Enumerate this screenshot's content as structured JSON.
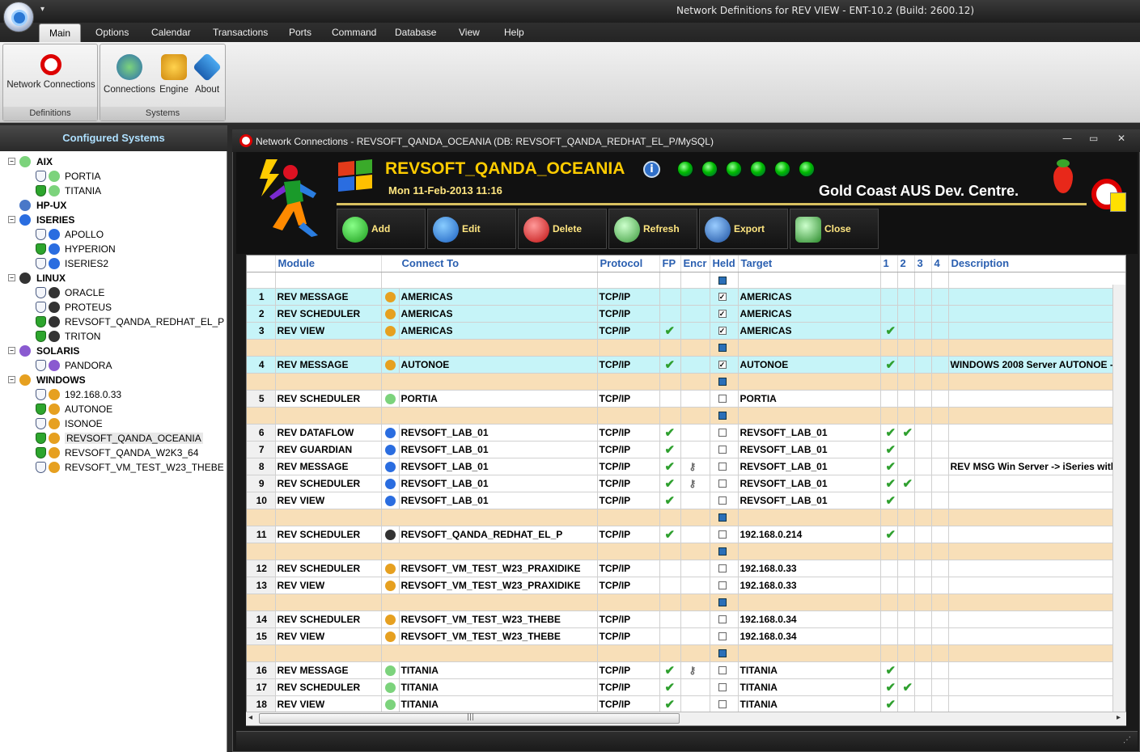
{
  "window": {
    "title": "Network Definitions for REV VIEW - ENT-10.2 (Build: 2600.12)"
  },
  "menu": [
    "Main",
    "Options",
    "Calendar",
    "Transactions",
    "Ports",
    "Command",
    "Database",
    "View",
    "Help"
  ],
  "ribbon": {
    "definitions": {
      "label": "Definitions",
      "network_connections": "Network Connections"
    },
    "systems": {
      "label": "Systems",
      "connections": "Connections",
      "engine": "Engine",
      "about": "About"
    }
  },
  "tree": {
    "title": "Configured Systems",
    "categories": [
      {
        "name": "AIX",
        "children": [
          "PORTIA",
          "TITANIA"
        ]
      },
      {
        "name": "HP-UX",
        "children": []
      },
      {
        "name": "ISERIES",
        "children": [
          "APOLLO",
          "HYPERION",
          "ISERIES2"
        ]
      },
      {
        "name": "LINUX",
        "children": [
          "ORACLE",
          "PROTEUS",
          "REVSOFT_QANDA_REDHAT_EL_P",
          "TRITON"
        ]
      },
      {
        "name": "SOLARIS",
        "children": [
          "PANDORA"
        ]
      },
      {
        "name": "WINDOWS",
        "children": [
          "192.168.0.33",
          "AUTONOE",
          "ISONOE",
          "REVSOFT_QANDA_OCEANIA",
          "REVSOFT_QANDA_W2K3_64",
          "REVSOFT_VM_TEST_W23_THEBE"
        ]
      }
    ]
  },
  "child": {
    "title": "Network Connections - REVSOFT_QANDA_OCEANIA (DB: REVSOFT_QANDA_REDHAT_EL_P/MySQL)",
    "system_name": "REVSOFT_QANDA_OCEANIA",
    "datetime": "Mon 11-Feb-2013 11:16",
    "location": "Gold Coast AUS Dev. Centre.",
    "toolbar": {
      "add": "Add",
      "edit": "Edit",
      "delete": "Delete",
      "refresh": "Refresh",
      "export": "Export",
      "close": "Close"
    }
  },
  "grid": {
    "headers": {
      "module": "Module",
      "connect_to": "Connect To",
      "protocol": "Protocol",
      "fp": "FP",
      "encr": "Encr",
      "held": "Held",
      "target": "Target",
      "c1": "1",
      "c2": "2",
      "c3": "3",
      "c4": "4",
      "description": "Description"
    },
    "rows": [
      {
        "n": "1",
        "module": "REV MESSAGE",
        "connect": "AMERICAS",
        "os": "windows",
        "protocol": "TCP/IP",
        "fp": false,
        "encr": false,
        "held": true,
        "target": "AMERICAS",
        "c1": false,
        "c2": false,
        "desc": "",
        "cyan": true
      },
      {
        "n": "2",
        "module": "REV SCHEDULER",
        "connect": "AMERICAS",
        "os": "windows",
        "protocol": "TCP/IP",
        "fp": false,
        "encr": false,
        "held": true,
        "target": "AMERICAS",
        "c1": false,
        "c2": false,
        "desc": "",
        "cyan": true
      },
      {
        "n": "3",
        "module": "REV VIEW",
        "connect": "AMERICAS",
        "os": "windows",
        "protocol": "TCP/IP",
        "fp": true,
        "encr": false,
        "held": true,
        "target": "AMERICAS",
        "c1": true,
        "c2": false,
        "desc": "",
        "cyan": true
      },
      {
        "sep": true
      },
      {
        "n": "4",
        "module": "REV MESSAGE",
        "connect": "AUTONOE",
        "os": "windows",
        "protocol": "TCP/IP",
        "fp": true,
        "encr": false,
        "held": true,
        "target": "AUTONOE",
        "c1": true,
        "c2": false,
        "desc": "WINDOWS 2008 Server AUTONOE -",
        "cyan": true
      },
      {
        "sep": true
      },
      {
        "n": "5",
        "module": "REV SCHEDULER",
        "connect": "PORTIA",
        "os": "aix",
        "protocol": "TCP/IP",
        "fp": false,
        "encr": false,
        "held": false,
        "target": "PORTIA",
        "c1": false,
        "c2": false,
        "desc": ""
      },
      {
        "sep": true
      },
      {
        "n": "6",
        "module": "REV DATAFLOW",
        "connect": "REVSOFT_LAB_01",
        "os": "iseries",
        "protocol": "TCP/IP",
        "fp": true,
        "encr": false,
        "held": false,
        "target": "REVSOFT_LAB_01",
        "c1": true,
        "c2": true,
        "desc": ""
      },
      {
        "n": "7",
        "module": "REV GUARDIAN",
        "connect": "REVSOFT_LAB_01",
        "os": "iseries",
        "protocol": "TCP/IP",
        "fp": true,
        "encr": false,
        "held": false,
        "target": "REVSOFT_LAB_01",
        "c1": true,
        "c2": false,
        "desc": ""
      },
      {
        "n": "8",
        "module": "REV MESSAGE",
        "connect": "REVSOFT_LAB_01",
        "os": "iseries",
        "protocol": "TCP/IP",
        "fp": true,
        "encr": true,
        "held": false,
        "target": "REVSOFT_LAB_01",
        "c1": true,
        "c2": false,
        "desc": "REV MSG Win Server -> iSeries with"
      },
      {
        "n": "9",
        "module": "REV SCHEDULER",
        "connect": "REVSOFT_LAB_01",
        "os": "iseries",
        "protocol": "TCP/IP",
        "fp": true,
        "encr": true,
        "held": false,
        "target": "REVSOFT_LAB_01",
        "c1": true,
        "c2": true,
        "desc": ""
      },
      {
        "n": "10",
        "module": "REV VIEW",
        "connect": "REVSOFT_LAB_01",
        "os": "iseries",
        "protocol": "TCP/IP",
        "fp": true,
        "encr": false,
        "held": false,
        "target": "REVSOFT_LAB_01",
        "c1": true,
        "c2": false,
        "desc": ""
      },
      {
        "sep": true
      },
      {
        "n": "11",
        "module": "REV SCHEDULER",
        "connect": "REVSOFT_QANDA_REDHAT_EL_P",
        "os": "linux",
        "protocol": "TCP/IP",
        "fp": true,
        "encr": false,
        "held": false,
        "target": "192.168.0.214",
        "c1": true,
        "c2": false,
        "desc": ""
      },
      {
        "sep": true
      },
      {
        "n": "12",
        "module": "REV SCHEDULER",
        "connect": "REVSOFT_VM_TEST_W23_PRAXIDIKE",
        "os": "windows",
        "protocol": "TCP/IP",
        "fp": false,
        "encr": false,
        "held": false,
        "target": "192.168.0.33",
        "c1": false,
        "c2": false,
        "desc": ""
      },
      {
        "n": "13",
        "module": "REV VIEW",
        "connect": "REVSOFT_VM_TEST_W23_PRAXIDIKE",
        "os": "windows",
        "protocol": "TCP/IP",
        "fp": false,
        "encr": false,
        "held": false,
        "target": "192.168.0.33",
        "c1": false,
        "c2": false,
        "desc": ""
      },
      {
        "sep": true
      },
      {
        "n": "14",
        "module": "REV SCHEDULER",
        "connect": "REVSOFT_VM_TEST_W23_THEBE",
        "os": "windows",
        "protocol": "TCP/IP",
        "fp": false,
        "encr": false,
        "held": false,
        "target": "192.168.0.34",
        "c1": false,
        "c2": false,
        "desc": ""
      },
      {
        "n": "15",
        "module": "REV VIEW",
        "connect": "REVSOFT_VM_TEST_W23_THEBE",
        "os": "windows",
        "protocol": "TCP/IP",
        "fp": false,
        "encr": false,
        "held": false,
        "target": "192.168.0.34",
        "c1": false,
        "c2": false,
        "desc": ""
      },
      {
        "sep": true
      },
      {
        "n": "16",
        "module": "REV MESSAGE",
        "connect": "TITANIA",
        "os": "aix",
        "protocol": "TCP/IP",
        "fp": true,
        "encr": true,
        "held": false,
        "target": "TITANIA",
        "c1": true,
        "c2": false,
        "desc": ""
      },
      {
        "n": "17",
        "module": "REV SCHEDULER",
        "connect": "TITANIA",
        "os": "aix",
        "protocol": "TCP/IP",
        "fp": true,
        "encr": false,
        "held": false,
        "target": "TITANIA",
        "c1": true,
        "c2": true,
        "desc": ""
      },
      {
        "n": "18",
        "module": "REV VIEW",
        "connect": "TITANIA",
        "os": "aix",
        "protocol": "TCP/IP",
        "fp": true,
        "encr": false,
        "held": false,
        "target": "TITANIA",
        "c1": true,
        "c2": false,
        "desc": ""
      }
    ]
  },
  "colors": {
    "accent_gold": "#ffcc00",
    "header_blue": "#2a5fb0",
    "row_cyan": "#c6f4f8",
    "row_separator": "#f8dfb8",
    "check_green": "#2fa02f"
  },
  "icons": {
    "os_windows": "windows-flag-icon",
    "os_aix": "aix-icon",
    "os_iseries": "iseries-icon",
    "os_linux": "tux-icon",
    "fp": "check-icon",
    "encr": "encryption-icon"
  }
}
